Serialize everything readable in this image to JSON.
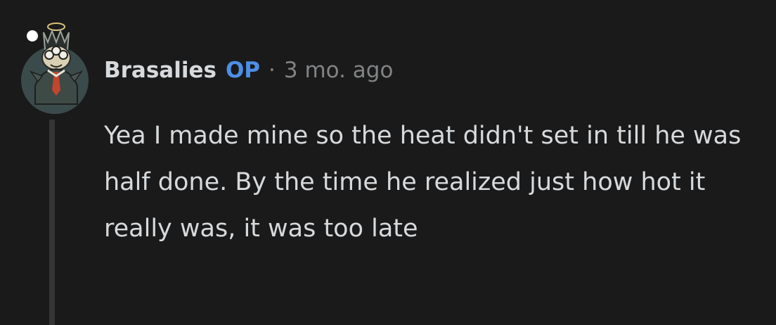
{
  "comment": {
    "author": "Brasalies",
    "badge": "OP",
    "separator": "·",
    "timestamp": "3 mo. ago",
    "body": "Yea I made mine so the heat didn't set in till he was half done. By the time he realized just how hot it really was, it was too late",
    "avatar_icon": "user-avatar-icon",
    "online_indicator": "online-status-icon"
  },
  "colors": {
    "background": "#1a1a1b",
    "text": "#d7dadc",
    "muted": "#818384",
    "op_accent": "#4e8ee6",
    "thread_line": "#343536"
  }
}
